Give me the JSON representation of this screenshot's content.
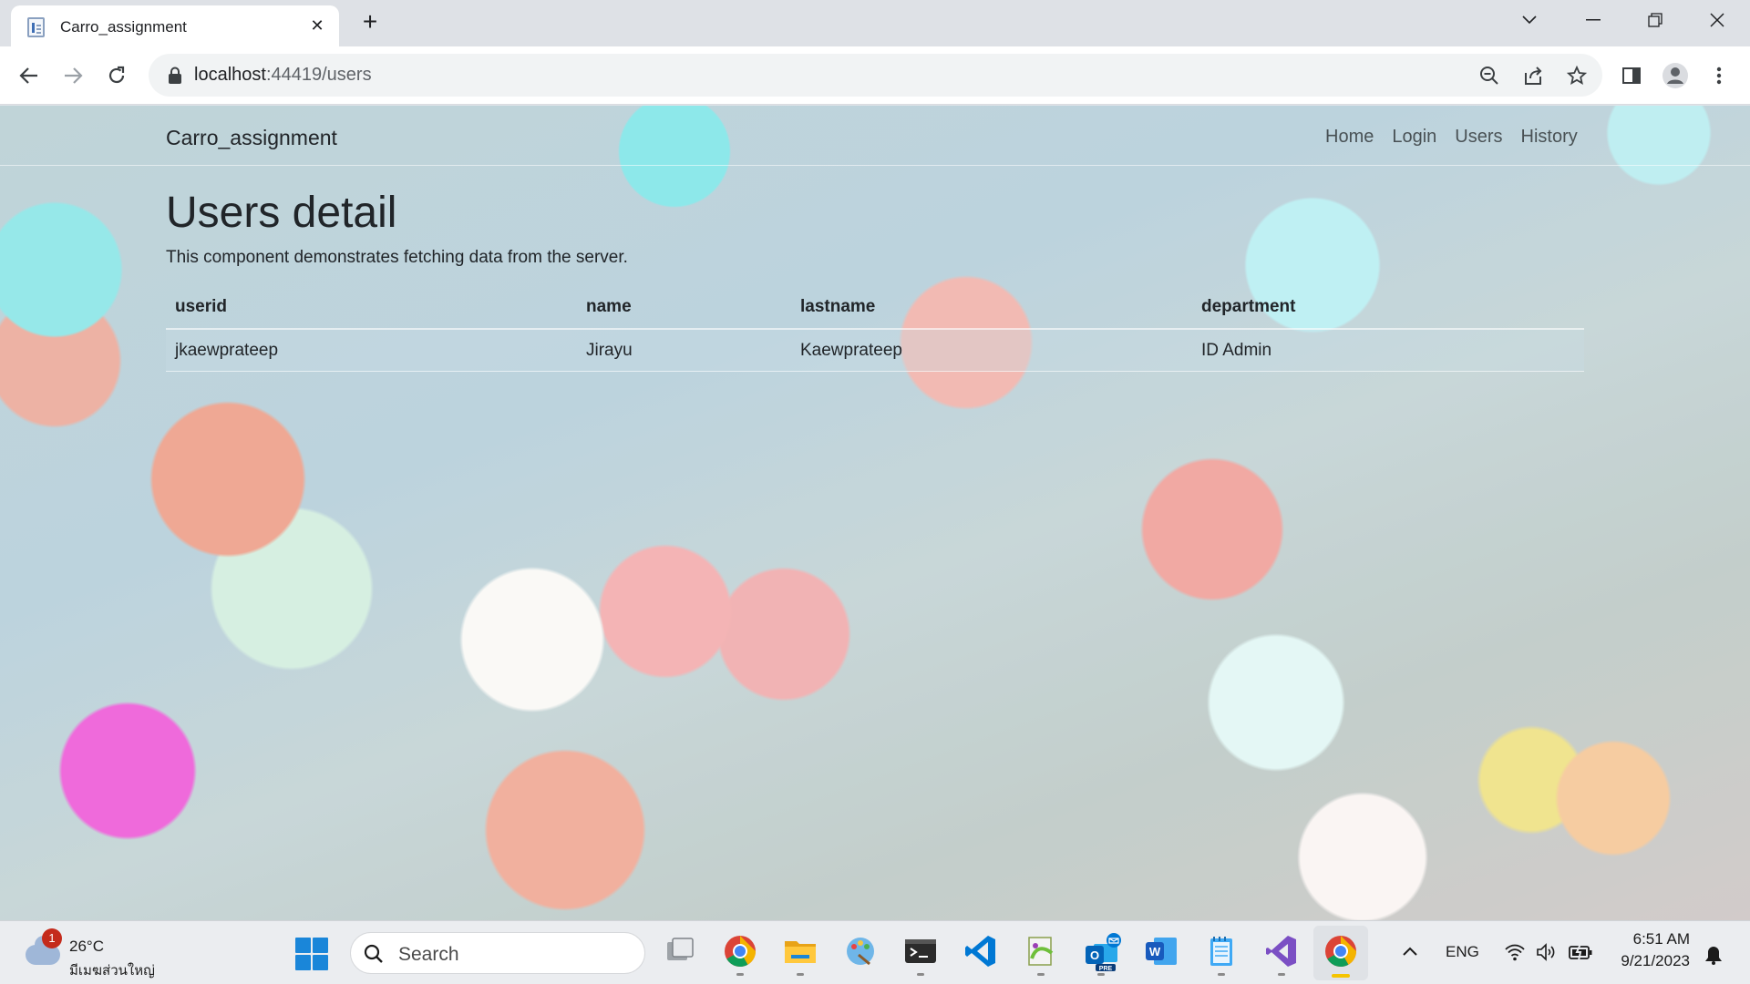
{
  "browser": {
    "tab_title": "Carro_assignment",
    "url_host": "localhost",
    "url_path": ":44419/users"
  },
  "navbar": {
    "brand": "Carro_assignment",
    "links": [
      "Home",
      "Login",
      "Users",
      "History"
    ]
  },
  "main": {
    "heading": "Users detail",
    "description": "This component demonstrates fetching data from the server.",
    "table": {
      "headers": [
        "userid",
        "name",
        "lastname",
        "department"
      ],
      "rows": [
        [
          "jkaewprateep",
          "Jirayu",
          "Kaewprateep",
          "ID Admin"
        ]
      ]
    }
  },
  "taskbar": {
    "weather_badge": "1",
    "weather_temp": "26°C",
    "weather_location": "มีเมฆส่วนใหญ่",
    "search_label": "Search",
    "apps": [
      "task-view",
      "chrome",
      "file-explorer",
      "paint",
      "terminal",
      "vscode",
      "notepad-plus",
      "outlook-pre",
      "word",
      "notepad",
      "visual-studio",
      "chrome-active"
    ],
    "language": "ENG",
    "time": "6:51 AM",
    "date": "9/21/2023"
  },
  "colors": {
    "accent": "#1a86d9",
    "active_indicator": "#f5c400",
    "badge": "#c42b1c"
  }
}
